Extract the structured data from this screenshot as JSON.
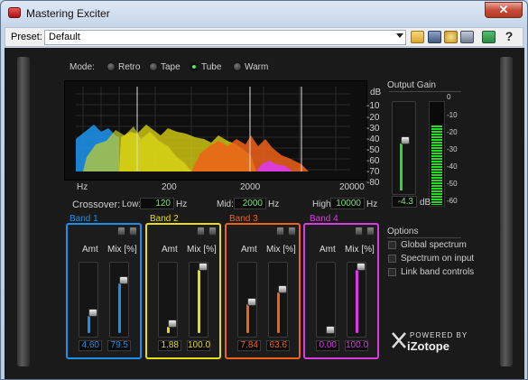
{
  "window": {
    "title": "Mastering Exciter",
    "close_label": "✕"
  },
  "toolbar": {
    "preset_label": "Preset:",
    "preset_value": "Default",
    "help_label": "?"
  },
  "mode": {
    "label": "Mode:",
    "options": [
      "Retro",
      "Tape",
      "Tube",
      "Warm"
    ],
    "selected": "Tube"
  },
  "spectrum": {
    "db_unit": "dB",
    "db_ticks": [
      "-10",
      "-20",
      "-30",
      "-40",
      "-50",
      "-60",
      "-70",
      "-80"
    ],
    "hz_unit": "Hz",
    "hz_ticks": [
      "200",
      "2000",
      "20000"
    ]
  },
  "crossover": {
    "label": "Crossover:",
    "low_label": "Low:",
    "low_value": "120",
    "low_unit": "Hz",
    "mid_label": "Mid:",
    "mid_value": "2000",
    "mid_unit": "Hz",
    "high_label": "High:",
    "high_value": "10000",
    "high_unit": "Hz"
  },
  "output": {
    "label": "Output Gain",
    "value": "-4.3",
    "unit": "dB",
    "meter_ticks": [
      "0",
      "-10",
      "-20",
      "-30",
      "-40",
      "-50",
      "-60"
    ],
    "level_fraction": 0.78,
    "fader_fraction": 0.58
  },
  "bands": [
    {
      "name": "Band 1",
      "color": "#1e8fe6",
      "amt_label": "Amt",
      "mix_label": "Mix [%]",
      "amt": "4.60",
      "mix": "79.5",
      "amt_fraction": 0.27,
      "mix_fraction": 0.78
    },
    {
      "name": "Band 2",
      "color": "#e6dc12",
      "amt_label": "Amt",
      "mix_label": "Mix [%]",
      "amt": "1.88",
      "mix": "100.0",
      "amt_fraction": 0.1,
      "mix_fraction": 1.0
    },
    {
      "name": "Band 3",
      "color": "#f0621a",
      "amt_label": "Amt",
      "mix_label": "Mix [%]",
      "amt": "7.84",
      "mix": "63.6",
      "amt_fraction": 0.45,
      "mix_fraction": 0.64
    },
    {
      "name": "Band 4",
      "color": "#d83ce0",
      "amt_label": "Amt",
      "mix_label": "Mix [%]",
      "amt": "0.00",
      "mix": "100.0",
      "amt_fraction": 0.0,
      "mix_fraction": 1.0
    }
  ],
  "options": {
    "title": "Options",
    "items": [
      "Global spectrum",
      "Spectrum on input",
      "Link band controls"
    ]
  },
  "brand": {
    "powered_by": "POWERED BY",
    "name": "iZotope"
  }
}
